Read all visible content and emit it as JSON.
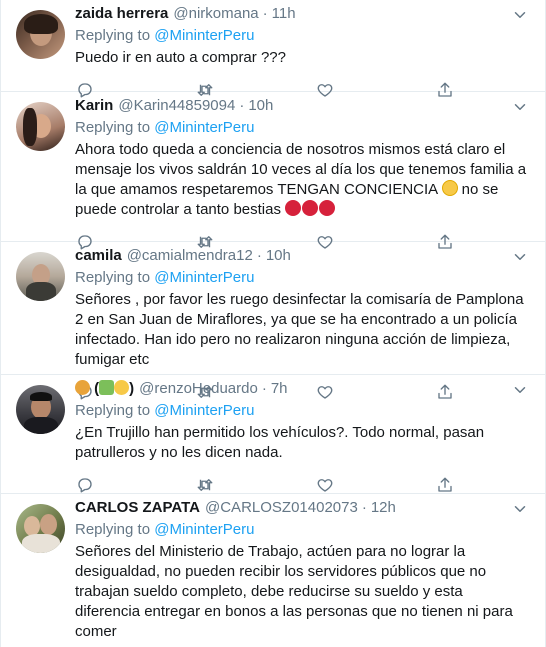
{
  "tweets": [
    {
      "name": "zaida herrera",
      "handle": "@nirkomana",
      "time": "11h",
      "replying_label": "Replying to",
      "replying_to": "@MininterPeru",
      "text": "Puedo ir en auto a comprar ???",
      "avatar_colors": [
        "#3a2a20",
        "#c49a7e"
      ]
    },
    {
      "name": "Karin",
      "handle": "@Karin44859094",
      "time": "10h",
      "replying_label": "Replying to",
      "replying_to": "@MininterPeru",
      "text": "Ahora todo queda a conciencia de nosotros mismos está claro el mensaje los vivos saldrán 10 veces al día los que tenemos familia a la que amamos respetaremos TENGAN CONCIENCIA",
      "text_tail": " no se puede controlar a tanto bestias ",
      "avatar_colors": [
        "#2b1d18",
        "#d8a98a"
      ]
    },
    {
      "name": "camila",
      "handle": "@camialmendra12",
      "time": "10h",
      "replying_label": "Replying to",
      "replying_to": "@MininterPeru",
      "text": "Señores , por favor les ruego desinfectar la comisaría de Pamplona 2 en San Juan de Miraflores, ya que se ha encontrado a un policía infectado. Han ido pero no realizaron ninguna acción de limpieza, fumigar etc",
      "avatar_colors": [
        "#5a5a52",
        "#b4a89a"
      ]
    },
    {
      "name": "(",
      "name_end": ")",
      "handle": "@renzoHeduardo",
      "time": "7h",
      "replying_label": "Replying to",
      "replying_to": "@MininterPeru",
      "text": "¿En Trujillo han permitido los vehículos?. Todo normal, pasan patrulleros y no les dicen nada.",
      "avatar_colors": [
        "#1e1e22",
        "#b6876a"
      ]
    },
    {
      "name": "CARLOS ZAPATA",
      "handle": "@CARLOSZ01402073",
      "time": "12h",
      "replying_label": "Replying to",
      "replying_to": "@MininterPeru",
      "text": "Señores del Ministerio de Trabajo, actúen para no lograr la desigualdad, no pueden recibir los servidores públicos que no trabajan sueldo completo, debe reducirse su sueldo y esta diferencia entregar en bonos a las personas que no tienen ni para comer",
      "avatar_colors": [
        "#6f7b4a",
        "#d9b89a"
      ]
    }
  ],
  "colors": {
    "link": "#1da1f2",
    "secondary": "#657786",
    "divider": "#e6ecf0"
  }
}
